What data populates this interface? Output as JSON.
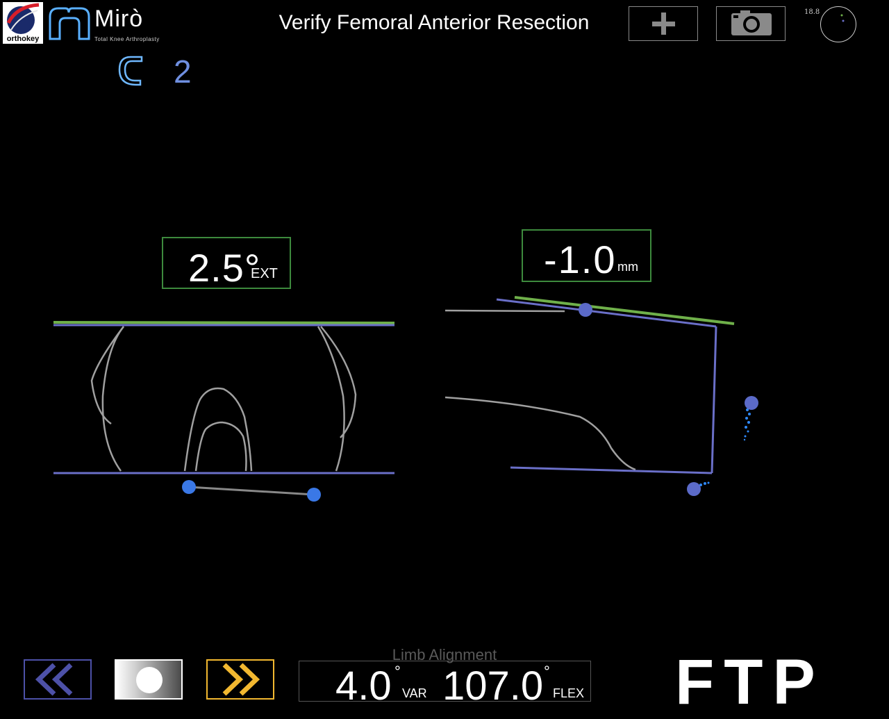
{
  "header": {
    "brand_text": "orthokey",
    "product_name": "Mirò",
    "product_subtitle": "Total Knee Arthroplasty",
    "title": "Verify Femoral Anterior Resection",
    "add_icon": "plus-icon",
    "camera_icon": "camera-icon",
    "tracker_value": "18.8"
  },
  "component": {
    "icon": "femoral-component-icon",
    "number": "2"
  },
  "measurements": {
    "rotation_value": "2.5°",
    "rotation_unit": "EXT",
    "offset_value": "-1.0",
    "offset_unit": "mm"
  },
  "colors": {
    "planned_line": "#6fb04a",
    "actual_line": "#6a6fc8",
    "bone_outline": "#a0a0a0",
    "marker": "#3a78e6",
    "next_accent": "#f2b830",
    "back_accent": "#4d51a8",
    "box_border": "#3d8a3d"
  },
  "footer": {
    "back_icon": "double-chevron-left-icon",
    "record_icon": "record-icon",
    "next_icon": "double-chevron-right-icon",
    "limb_label": "Limb Alignment",
    "varus_value": "4.0",
    "varus_degree": "°",
    "varus_unit": "VAR",
    "flex_value": "107.0",
    "flex_degree": "°",
    "flex_unit": "FLEX",
    "mode": "FTP"
  }
}
